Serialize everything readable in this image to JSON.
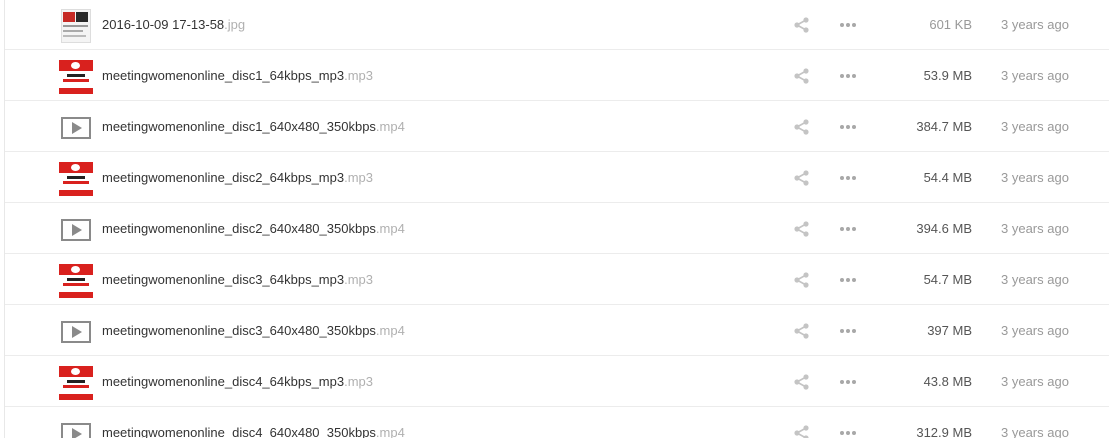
{
  "files": [
    {
      "name": "2016-10-09 17-13-58",
      "ext": ".jpg",
      "kind": "jpg",
      "size": "601 KB",
      "size_muted": true,
      "age": "3 years ago"
    },
    {
      "name": "meetingwomenonline_disc1_64kbps_mp3",
      "ext": ".mp3",
      "kind": "mp3",
      "size": "53.9 MB",
      "size_muted": false,
      "age": "3 years ago"
    },
    {
      "name": "meetingwomenonline_disc1_640x480_350kbps",
      "ext": ".mp4",
      "kind": "mp4",
      "size": "384.7 MB",
      "size_muted": false,
      "age": "3 years ago"
    },
    {
      "name": "meetingwomenonline_disc2_64kbps_mp3",
      "ext": ".mp3",
      "kind": "mp3",
      "size": "54.4 MB",
      "size_muted": false,
      "age": "3 years ago"
    },
    {
      "name": "meetingwomenonline_disc2_640x480_350kbps",
      "ext": ".mp4",
      "kind": "mp4",
      "size": "394.6 MB",
      "size_muted": false,
      "age": "3 years ago"
    },
    {
      "name": "meetingwomenonline_disc3_64kbps_mp3",
      "ext": ".mp3",
      "kind": "mp3",
      "size": "54.7 MB",
      "size_muted": false,
      "age": "3 years ago"
    },
    {
      "name": "meetingwomenonline_disc3_640x480_350kbps",
      "ext": ".mp4",
      "kind": "mp4",
      "size": "397 MB",
      "size_muted": false,
      "age": "3 years ago"
    },
    {
      "name": "meetingwomenonline_disc4_64kbps_mp3",
      "ext": ".mp3",
      "kind": "mp3",
      "size": "43.8 MB",
      "size_muted": false,
      "age": "3 years ago"
    },
    {
      "name": "meetingwomenonline_disc4_640x480_350kbps",
      "ext": ".mp4",
      "kind": "mp4",
      "size": "312.9 MB",
      "size_muted": false,
      "age": "3 years ago"
    }
  ],
  "icons": {
    "share": "share-icon",
    "more": "more-options-icon",
    "video": "video-play-icon",
    "audio_cover": "audio-cover-thumbnail",
    "image": "image-thumbnail"
  },
  "colors": {
    "accent_red": "#d9211e",
    "row_divider": "#ececec",
    "muted_text": "#999999",
    "ext_text": "#b0b0b0"
  }
}
